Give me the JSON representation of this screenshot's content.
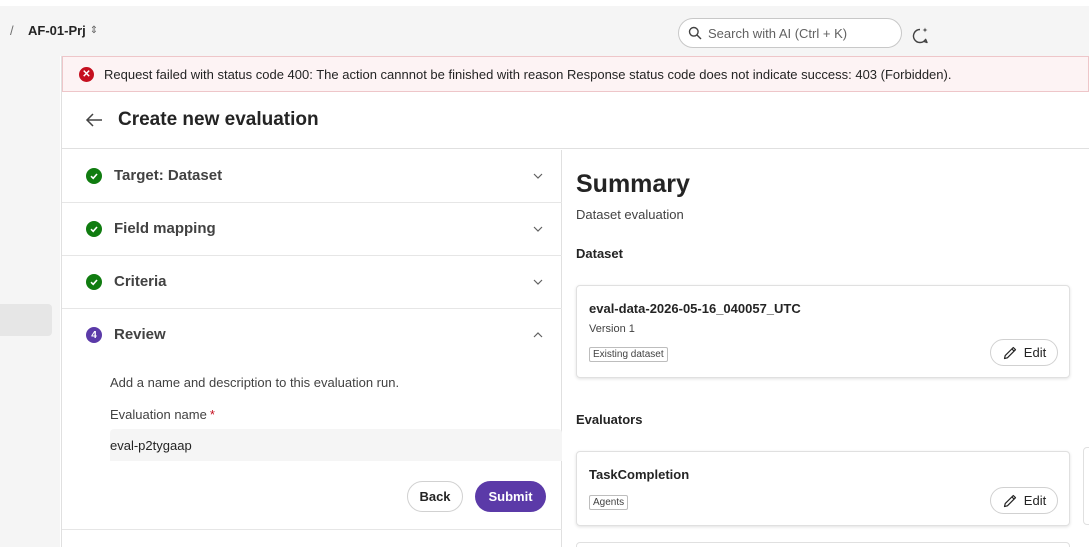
{
  "topbar": {
    "separator": "/",
    "project_name": "AF-01-Prj",
    "search_placeholder": "Search with AI (Ctrl + K)"
  },
  "error": {
    "message": "Request failed with status code 400: The action cannnot be finished with reason Response status code does not indicate success: 403 (Forbidden)."
  },
  "page": {
    "title": "Create new evaluation"
  },
  "steps": [
    {
      "label": "Target: Dataset",
      "status": "complete"
    },
    {
      "label": "Field mapping",
      "status": "complete"
    },
    {
      "label": "Criteria",
      "status": "complete"
    },
    {
      "label": "Review",
      "status": "current",
      "number": "4"
    }
  ],
  "review": {
    "description": "Add a name and description to this evaluation run.",
    "name_label": "Evaluation name",
    "required_marker": "*",
    "name_value": "eval-p2tygaap",
    "back_label": "Back",
    "submit_label": "Submit"
  },
  "summary": {
    "title": "Summary",
    "subtitle": "Dataset evaluation",
    "dataset_section": "Dataset",
    "dataset_name": "eval-data-2026-05-16_040057_UTC",
    "dataset_version": "Version 1",
    "dataset_tag": "Existing dataset",
    "evaluators_section": "Evaluators",
    "evaluator_name": "TaskCompletion",
    "evaluator_tag": "Agents",
    "edit_label": "Edit"
  },
  "colors": {
    "accent": "#5b3aa8",
    "success": "#107c10",
    "error": "#c50f1f",
    "error_bg": "#fdf3f4"
  }
}
